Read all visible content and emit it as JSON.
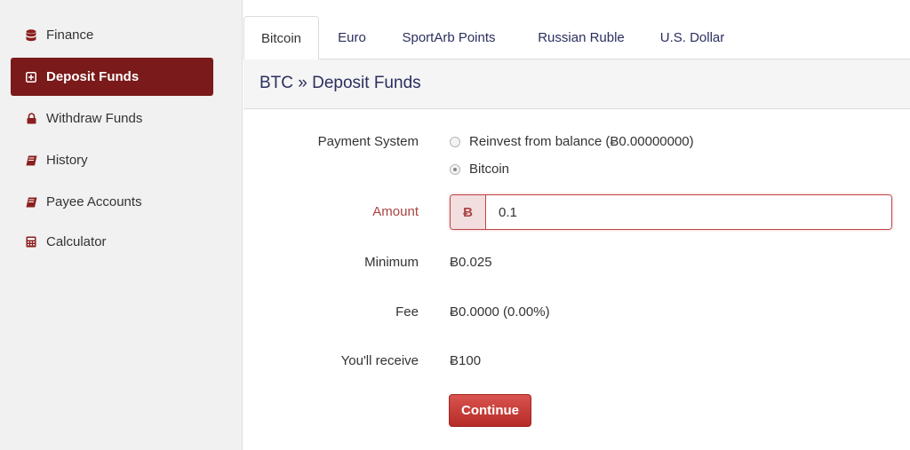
{
  "sidebar": {
    "items": [
      {
        "label": "Finance",
        "icon": "database-icon"
      },
      {
        "label": "Deposit Funds",
        "icon": "plus-square-icon",
        "active": true
      },
      {
        "label": "Withdraw Funds",
        "icon": "lock-icon"
      },
      {
        "label": "History",
        "icon": "book-icon"
      },
      {
        "label": "Payee Accounts",
        "icon": "book-icon"
      },
      {
        "label": "Calculator",
        "icon": "calculator-icon"
      }
    ]
  },
  "tabs": [
    "Bitcoin",
    "Euro",
    "SportArb Points",
    "Russian Ruble",
    "U.S. Dollar"
  ],
  "active_tab": "Bitcoin",
  "panel": {
    "title": "BTC » Deposit Funds"
  },
  "form": {
    "payment_system_label": "Payment System",
    "options": [
      "Reinvest from balance (Ƀ0.00000000)",
      "Bitcoin"
    ],
    "selected_option": "Bitcoin",
    "amount_label": "Amount",
    "currency_symbol": "Ƀ",
    "amount_value": "0.1",
    "minimum_label": "Minimum",
    "minimum_value": "Ƀ0.025",
    "fee_label": "Fee",
    "fee_value": "Ƀ0.0000 (0.00%)",
    "receive_label": "You'll receive",
    "receive_value": "Ƀ100",
    "continue_label": "Continue"
  },
  "colors": {
    "accent": "#7b1a1a",
    "button": "#c9302c",
    "error_border": "#c0444a",
    "title_text": "#2b2f5e"
  }
}
